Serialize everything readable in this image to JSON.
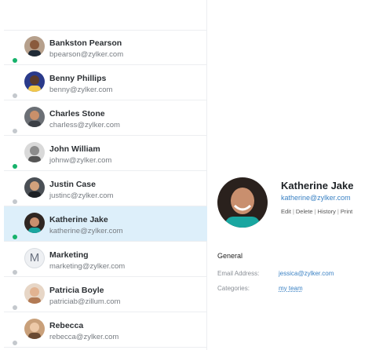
{
  "contacts": [
    {
      "name": "Bankston Pearson",
      "email": "bpearson@zylker.com",
      "status": "online"
    },
    {
      "name": "Benny Phillips",
      "email": "benny@zylker.com",
      "status": "offline"
    },
    {
      "name": "Charles Stone",
      "email": "charless@zylker.com",
      "status": "offline"
    },
    {
      "name": "John William",
      "email": "johnw@zylker.com",
      "status": "online"
    },
    {
      "name": "Justin Case",
      "email": "justinc@zylker.com",
      "status": "offline"
    },
    {
      "name": "Katherine Jake",
      "email": "katherine@zylker.com",
      "status": "online",
      "selected": true
    },
    {
      "name": "Marketing",
      "email": "marketing@zylker.com",
      "status": "offline",
      "initial": "M"
    },
    {
      "name": "Patricia Boyle",
      "email": "patriciab@zillum.com",
      "status": "offline"
    },
    {
      "name": "Rebecca",
      "email": "rebecca@zylker.com",
      "status": "offline"
    }
  ],
  "detail": {
    "name": "Katherine Jake",
    "email": "katherine@zylker.com",
    "actions": [
      "Edit",
      "Delete",
      "History",
      "Print"
    ],
    "section_title": "General",
    "fields": [
      {
        "label": "Email Address:",
        "value": "jessica@zylker.com"
      },
      {
        "label": "Categories:",
        "value": "my team"
      }
    ]
  },
  "colors": {
    "online": "#16b26b",
    "offline": "#c4c8cd",
    "selected_row": "#ddeffa",
    "link": "#3b82c4"
  }
}
